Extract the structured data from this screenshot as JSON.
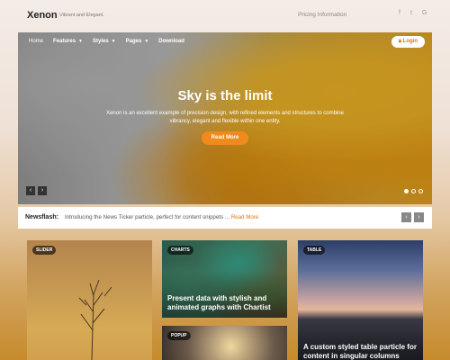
{
  "header": {
    "brand": "Xenon",
    "tagline": "Vibrant and Elegant.",
    "pricing_link": "Pricing Information",
    "social": [
      {
        "icon": "facebook-icon",
        "glyph": "f"
      },
      {
        "icon": "twitter-icon",
        "glyph": "t"
      },
      {
        "icon": "google-plus-icon",
        "glyph": "G"
      }
    ]
  },
  "nav": {
    "items": [
      {
        "label": "Home",
        "dropdown": false
      },
      {
        "label": "Features",
        "dropdown": true
      },
      {
        "label": "Styles",
        "dropdown": true
      },
      {
        "label": "Pages",
        "dropdown": true
      },
      {
        "label": "Download",
        "dropdown": false
      }
    ],
    "login_label": "Login"
  },
  "hero": {
    "title": "Sky is the limit",
    "description": "Xenon is an excellent example of precision design, with refined elements and structures to combine vibrancy, elegant and flexible within one entity.",
    "button_label": "Read More",
    "prev_glyph": "‹",
    "next_glyph": "›",
    "slides_total": 3,
    "active_slide": 1
  },
  "newsflash": {
    "label": "Newsflash:",
    "text": "Introducing the News Ticker particle, perfect for content snippets ...",
    "read_more": "Read More",
    "prev_glyph": "‹",
    "next_glyph": "›"
  },
  "cards": [
    {
      "badge": "SLIDER",
      "title": ""
    },
    {
      "badge": "CHARTS",
      "title": "Present data with stylish and animated graphs with Chartist"
    },
    {
      "badge": "POPUP",
      "title": ""
    },
    {
      "badge": "TABLE",
      "title": "A custom styled table particle for content in singular columns"
    }
  ],
  "colors": {
    "accent": "#f08a1c",
    "login_text": "#e8720c"
  }
}
